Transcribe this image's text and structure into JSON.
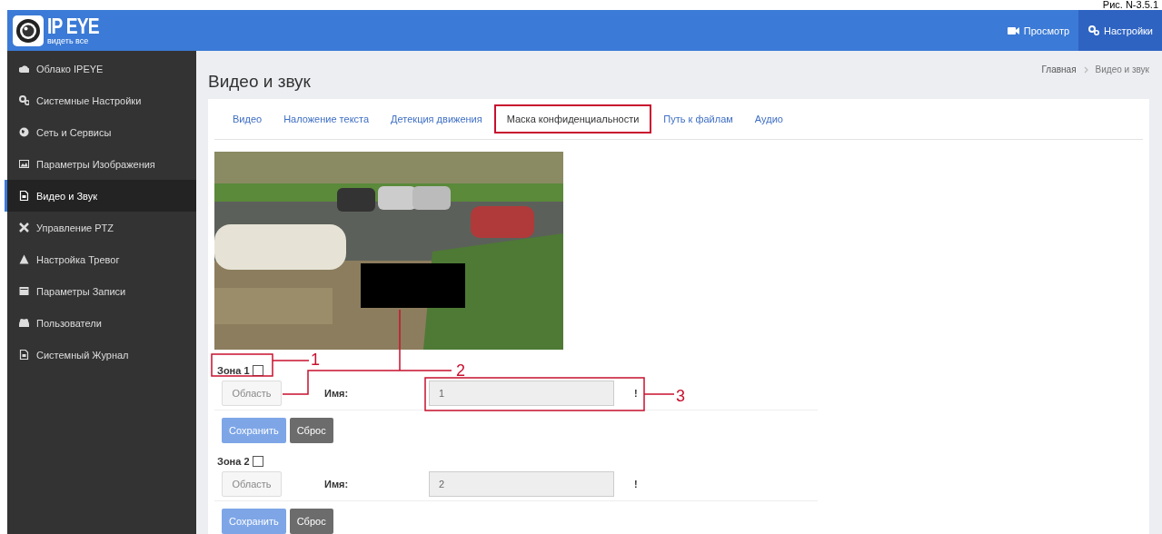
{
  "caption": "Рис. N-3.5.1",
  "header": {
    "logo_title": "IP EYE",
    "logo_tagline": "видеть все",
    "nav": [
      {
        "label": "Просмотр",
        "kind": "camera",
        "selected": false
      },
      {
        "label": "Настройки",
        "kind": "gears",
        "selected": true
      }
    ]
  },
  "sidebar": {
    "items": [
      {
        "label": "Облако IPEYE",
        "kind": "cloud",
        "selected": false
      },
      {
        "label": "Системные Настройки",
        "kind": "gears",
        "selected": false
      },
      {
        "label": "Сеть и Сервисы",
        "kind": "globe",
        "selected": false
      },
      {
        "label": "Параметры Изображения",
        "kind": "picture",
        "selected": false
      },
      {
        "label": "Видео и Звук",
        "kind": "file",
        "selected": true
      },
      {
        "label": "Управление PTZ",
        "kind": "cross",
        "selected": false
      },
      {
        "label": "Настройка Тревог",
        "kind": "warning",
        "selected": false
      },
      {
        "label": "Параметры Записи",
        "kind": "drive",
        "selected": false
      },
      {
        "label": "Пользователи",
        "kind": "users",
        "selected": false
      },
      {
        "label": "Системный Журнал",
        "kind": "file",
        "selected": false
      }
    ]
  },
  "page": {
    "title": "Видео и звук",
    "breadcrumb": [
      "Главная",
      "Видео и звук"
    ]
  },
  "tabs": [
    {
      "label": "Видео",
      "selected": false
    },
    {
      "label": "Наложение текста",
      "selected": false
    },
    {
      "label": "Детекция движения",
      "selected": false
    },
    {
      "label": "Маска конфиденциальности",
      "selected": true
    },
    {
      "label": "Путь к файлам",
      "selected": false
    },
    {
      "label": "Аудио",
      "selected": false
    }
  ],
  "zones": [
    {
      "title": "Зона 1",
      "checked": false,
      "area_button": "Область",
      "name_label": "Имя:",
      "name_value": "1",
      "flag": "!",
      "save_button": "Сохранить",
      "reset_button": "Сброс"
    },
    {
      "title": "Зона 2",
      "checked": false,
      "area_button": "Область",
      "name_label": "Имя:",
      "name_value": "2",
      "flag": "!",
      "save_button": "Сохранить",
      "reset_button": "Сброс"
    }
  ],
  "callouts": [
    {
      "label": "1"
    },
    {
      "label": "2"
    },
    {
      "label": "3"
    }
  ]
}
